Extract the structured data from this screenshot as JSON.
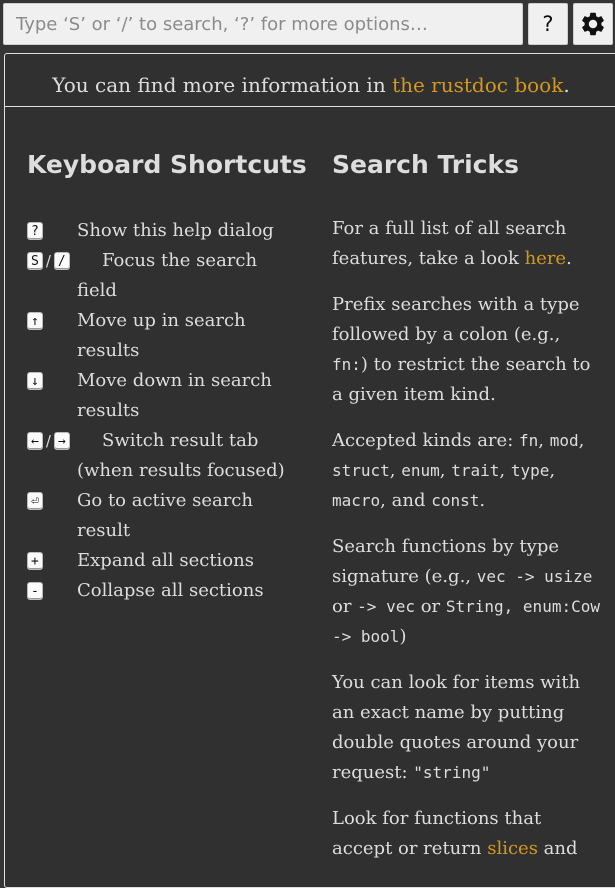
{
  "search": {
    "placeholder": "Type ‘S’ or ‘/’ to search, ‘?’ for more options…"
  },
  "help_button": "?",
  "info": {
    "prefix": "You can find more information in ",
    "link": "the rustdoc book",
    "suffix": "."
  },
  "shortcuts": {
    "heading": "Keyboard Shortcuts",
    "items": [
      {
        "keys": [
          "?"
        ],
        "desc": "Show this help dialog"
      },
      {
        "keys": [
          "S",
          "/"
        ],
        "desc": "Focus the search field"
      },
      {
        "keys": [
          "↑"
        ],
        "desc": "Move up in search results"
      },
      {
        "keys": [
          "↓"
        ],
        "desc": "Move down in search results"
      },
      {
        "keys": [
          "←",
          "→"
        ],
        "desc": "Switch result tab (when results focused)"
      },
      {
        "keys": [
          "⏎"
        ],
        "desc": "Go to active search result"
      },
      {
        "keys": [
          "+"
        ],
        "desc": "Expand all sections"
      },
      {
        "keys": [
          "-"
        ],
        "desc": "Collapse all sections"
      }
    ],
    "separator": "/"
  },
  "tricks": {
    "heading": "Search Tricks",
    "p1": {
      "text": "For a full list of all search features, take a look ",
      "link": "here",
      "end": "."
    },
    "p2": {
      "a": "Prefix searches with a type followed by a colon (e.g., ",
      "code": "fn:",
      "b": ") to restrict the search to a given item kind."
    },
    "p3": {
      "a": "Accepted kinds are: ",
      "k1": "fn",
      "s1": ", ",
      "k2": "mod",
      "s2": ", ",
      "k3": "struct",
      "s3": ", ",
      "k4": "enum",
      "s4": ", ",
      "k5": "trait",
      "s5": ", ",
      "k6": "type",
      "s6": ", ",
      "k7": "macro",
      "s7": ", and ",
      "k8": "const",
      "end": "."
    },
    "p4": {
      "a": "Search functions by type signature (e.g., ",
      "c1": "vec -> usize",
      "b": " or ",
      "c2": "-> vec",
      "c": " or ",
      "c3": "String, enum:Cow -> bool",
      "end": ")"
    },
    "p5": {
      "a": "You can look for items with an exact name by putting double quotes around your request: ",
      "code": "\"string\""
    },
    "p6": {
      "a": "Look for functions that accept or return ",
      "link": "slices",
      "b": " and"
    }
  }
}
